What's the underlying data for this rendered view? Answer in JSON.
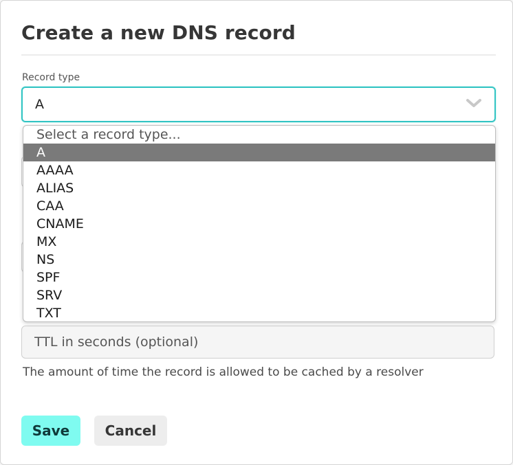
{
  "dialog": {
    "title": "Create a new DNS record"
  },
  "record_type": {
    "label": "Record type",
    "selected": "A",
    "options": [
      {
        "label": "Select a record type...",
        "placeholder": true
      },
      {
        "label": "A",
        "selected": true
      },
      {
        "label": "AAAA"
      },
      {
        "label": "ALIAS"
      },
      {
        "label": "CAA"
      },
      {
        "label": "CNAME"
      },
      {
        "label": "MX"
      },
      {
        "label": "NS"
      },
      {
        "label": "SPF"
      },
      {
        "label": "SRV"
      },
      {
        "label": "TXT"
      }
    ]
  },
  "ttl": {
    "placeholder": "TTL in seconds (optional)",
    "value": "",
    "help": "The amount of time the record is allowed to be cached by a resolver"
  },
  "actions": {
    "save_label": "Save",
    "cancel_label": "Cancel"
  },
  "colors": {
    "focus_border": "#33c4c4",
    "save_bg": "#7ffbf0",
    "selected_option_bg": "#7a7a7a"
  }
}
